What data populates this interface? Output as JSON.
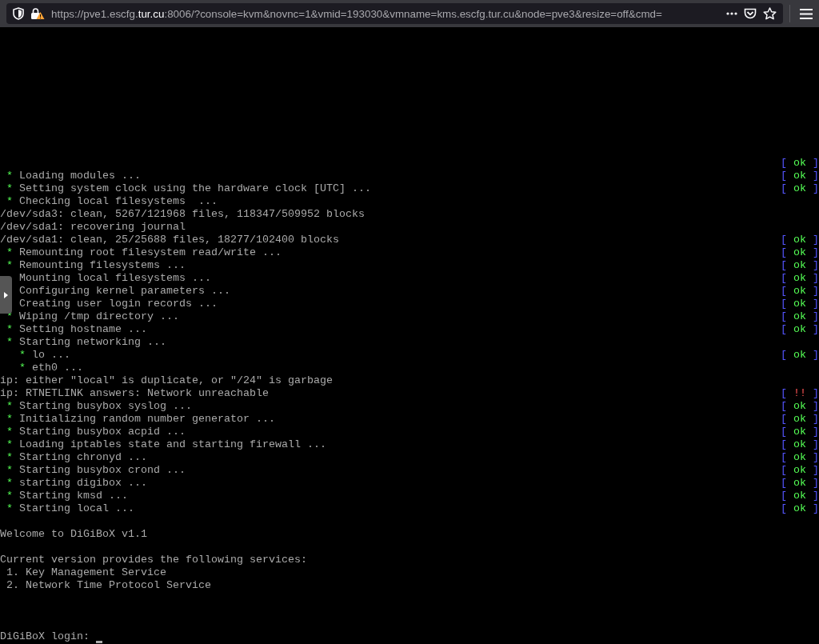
{
  "browser": {
    "url": {
      "scheme": "https://",
      "host_prefix": "pve1.escfg.",
      "domain": "tur.cu",
      "rest": ":8006/?console=kvm&novnc=1&vmid=193030&vmname=kms.escfg.tur.cu&node=pve3&resize=off&cmd="
    }
  },
  "console": {
    "lines": [
      {
        "kind": "task",
        "status": {
          "kind": "ok",
          "open": "[",
          "text": "ok",
          "close": "]"
        }
      },
      {
        "kind": "task",
        "bullet": "*",
        "text": "Loading modules ...",
        "status": {
          "kind": "ok",
          "open": "[",
          "text": "ok",
          "close": "]"
        }
      },
      {
        "kind": "task",
        "bullet": "*",
        "text": "Setting system clock using the hardware clock [UTC] ...",
        "status": {
          "kind": "ok",
          "open": "[",
          "text": "ok",
          "close": "]"
        }
      },
      {
        "kind": "task",
        "bullet": "*",
        "text": "Checking local filesystems  ..."
      },
      {
        "kind": "plain",
        "text": "/dev/sda3: clean, 5267/121968 files, 118347/509952 blocks"
      },
      {
        "kind": "plain",
        "text": "/dev/sda1: recovering journal"
      },
      {
        "kind": "plain",
        "text": "/dev/sda1: clean, 25/25688 files, 18277/102400 blocks",
        "status": {
          "kind": "ok",
          "open": "[",
          "text": "ok",
          "close": "]"
        }
      },
      {
        "kind": "task",
        "bullet": "*",
        "text": "Remounting root filesystem read/write ...",
        "status": {
          "kind": "ok",
          "open": "[",
          "text": "ok",
          "close": "]"
        }
      },
      {
        "kind": "task",
        "bullet": "*",
        "text": "Remounting filesystems ...",
        "status": {
          "kind": "ok",
          "open": "[",
          "text": "ok",
          "close": "]"
        }
      },
      {
        "kind": "task",
        "text": "Mounting local filesystems ...",
        "status": {
          "kind": "ok",
          "open": "[",
          "text": "ok",
          "close": "]"
        }
      },
      {
        "kind": "task",
        "text": "Configuring kernel parameters ...",
        "status": {
          "kind": "ok",
          "open": "[",
          "text": "ok",
          "close": "]"
        }
      },
      {
        "kind": "task",
        "text": "Creating user login records ...",
        "status": {
          "kind": "ok",
          "open": "[",
          "text": "ok",
          "close": "]"
        }
      },
      {
        "kind": "task",
        "bullet": "*",
        "text": "Wiping /tmp directory ...",
        "status": {
          "kind": "ok",
          "open": "[",
          "text": "ok",
          "close": "]"
        }
      },
      {
        "kind": "task",
        "bullet": "*",
        "text": "Setting hostname ...",
        "status": {
          "kind": "ok",
          "open": "[",
          "text": "ok",
          "close": "]"
        }
      },
      {
        "kind": "task",
        "bullet": "*",
        "text": "Starting networking ...",
        "children": [
          {
            "kind": "task",
            "bullet": "*",
            "text": "lo ...",
            "status": {
              "kind": "ok",
              "open": "[",
              "text": "ok",
              "close": "]"
            }
          },
          {
            "kind": "task",
            "bullet": "*",
            "text": "eth0 ..."
          }
        ]
      },
      {
        "kind": "plain",
        "text": "ip: either \"local\" is duplicate, or \"/24\" is garbage"
      },
      {
        "kind": "plain",
        "text": "ip: RTNETLINK answers: Network unreachable",
        "status": {
          "kind": "error",
          "open": "[",
          "text": "!!",
          "close": "]"
        }
      },
      {
        "kind": "task",
        "bullet": "*",
        "text": "Starting busybox syslog ...",
        "status": {
          "kind": "ok",
          "open": "[",
          "text": "ok",
          "close": "]"
        }
      },
      {
        "kind": "task",
        "bullet": "*",
        "text": "Initializing random number generator ...",
        "status": {
          "kind": "ok",
          "open": "[",
          "text": "ok",
          "close": "]"
        }
      },
      {
        "kind": "task",
        "bullet": "*",
        "text": "Starting busybox acpid ...",
        "status": {
          "kind": "ok",
          "open": "[",
          "text": "ok",
          "close": "]"
        }
      },
      {
        "kind": "task",
        "bullet": "*",
        "text": "Loading iptables state and starting firewall ...",
        "status": {
          "kind": "ok",
          "open": "[",
          "text": "ok",
          "close": "]"
        }
      },
      {
        "kind": "task",
        "bullet": "*",
        "text": "Starting chronyd ...",
        "status": {
          "kind": "ok",
          "open": "[",
          "text": "ok",
          "close": "]"
        }
      },
      {
        "kind": "task",
        "bullet": "*",
        "text": "Starting busybox crond ...",
        "status": {
          "kind": "ok",
          "open": "[",
          "text": "ok",
          "close": "]"
        }
      },
      {
        "kind": "task",
        "bullet": "*",
        "text": "starting digibox ...",
        "status": {
          "kind": "ok",
          "open": "[",
          "text": "ok",
          "close": "]"
        }
      },
      {
        "kind": "task",
        "bullet": "*",
        "text": "Starting kmsd ...",
        "status": {
          "kind": "ok",
          "open": "[",
          "text": "ok",
          "close": "]"
        }
      },
      {
        "kind": "task",
        "bullet": "*",
        "text": "Starting local ...",
        "status": {
          "kind": "ok",
          "open": "[",
          "text": "ok",
          "close": "]"
        }
      },
      {
        "kind": "blank"
      },
      {
        "kind": "plain",
        "text": "Welcome to DiGiBoX v1.1"
      },
      {
        "kind": "blank"
      },
      {
        "kind": "plain",
        "text": "Current version provides the following services:"
      },
      {
        "kind": "item",
        "text": "1. Key Management Service"
      },
      {
        "kind": "item",
        "text": "2. Network Time Protocol Service"
      },
      {
        "kind": "blank"
      },
      {
        "kind": "blank"
      },
      {
        "kind": "blank"
      },
      {
        "kind": "prompt",
        "text": "DiGiBoX login:"
      }
    ]
  }
}
